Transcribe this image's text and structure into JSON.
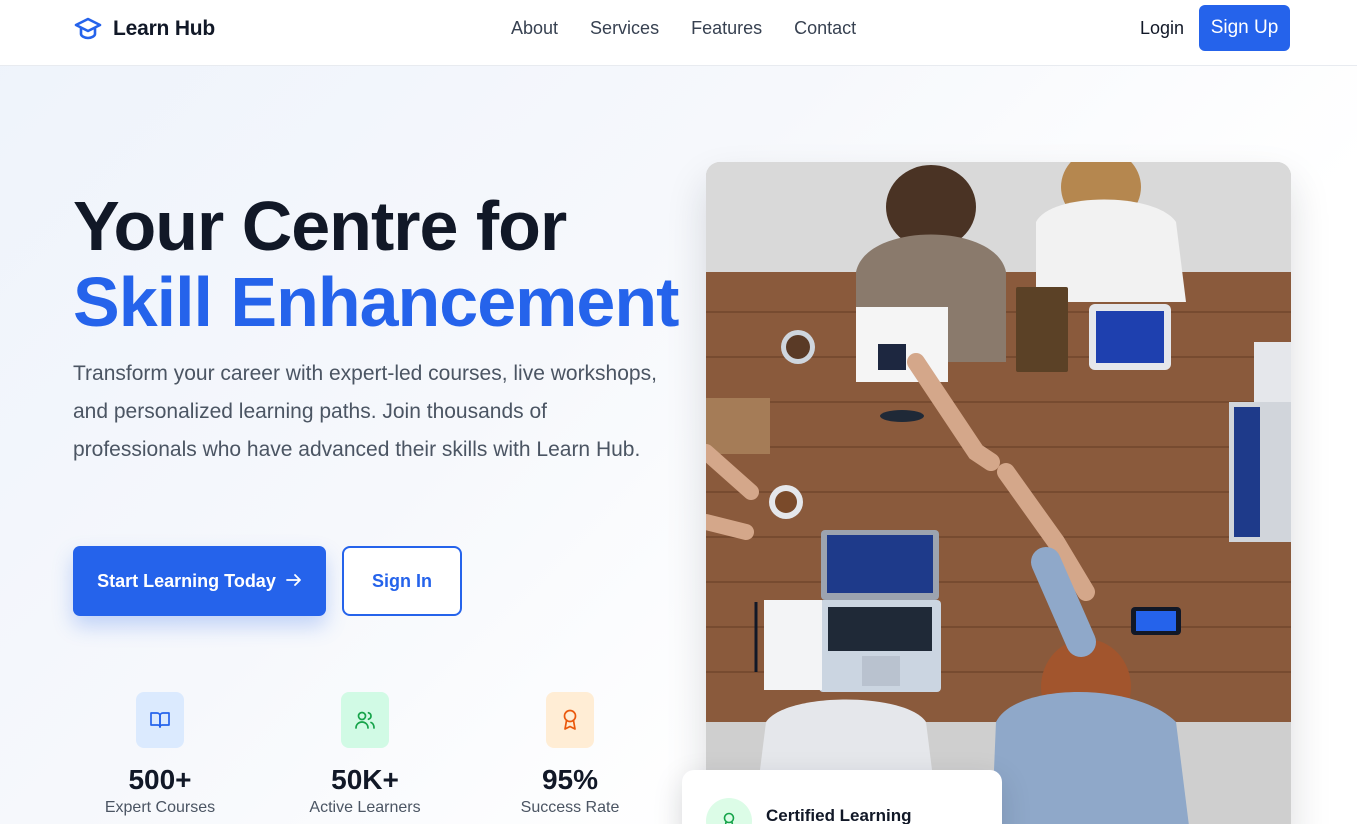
{
  "nav": {
    "brand": "Learn Hub",
    "links": [
      "About",
      "Services",
      "Features",
      "Contact"
    ],
    "login": "Login",
    "signup": "Sign Up"
  },
  "hero": {
    "title_line1": "Your Centre for",
    "title_line2": "Skill Enhancement",
    "description": "Transform your career with expert-led courses, live workshops, and personalized learning paths. Join thousands of professionals who have advanced their skills with Learn Hub.",
    "cta_primary": "Start Learning Today",
    "cta_primary_icon": "arrow-right-icon",
    "cta_secondary": "Sign In"
  },
  "stats": [
    {
      "value": "500+",
      "label": "Expert Courses",
      "icon": "book-open-icon",
      "color": "#2563eb",
      "bg": "#dbeafe"
    },
    {
      "value": "50K+",
      "label": "Active Learners",
      "icon": "users-icon",
      "color": "#16a34a",
      "bg": "#d1fae5"
    },
    {
      "value": "95%",
      "label": "Success Rate",
      "icon": "award-icon",
      "color": "#ea580c",
      "bg": "#ffedd5"
    }
  ],
  "badge": {
    "title": "Certified Learning",
    "icon": "award-icon"
  },
  "colors": {
    "accent": "#2563eb",
    "text": "#111827",
    "muted": "#4b5563"
  }
}
